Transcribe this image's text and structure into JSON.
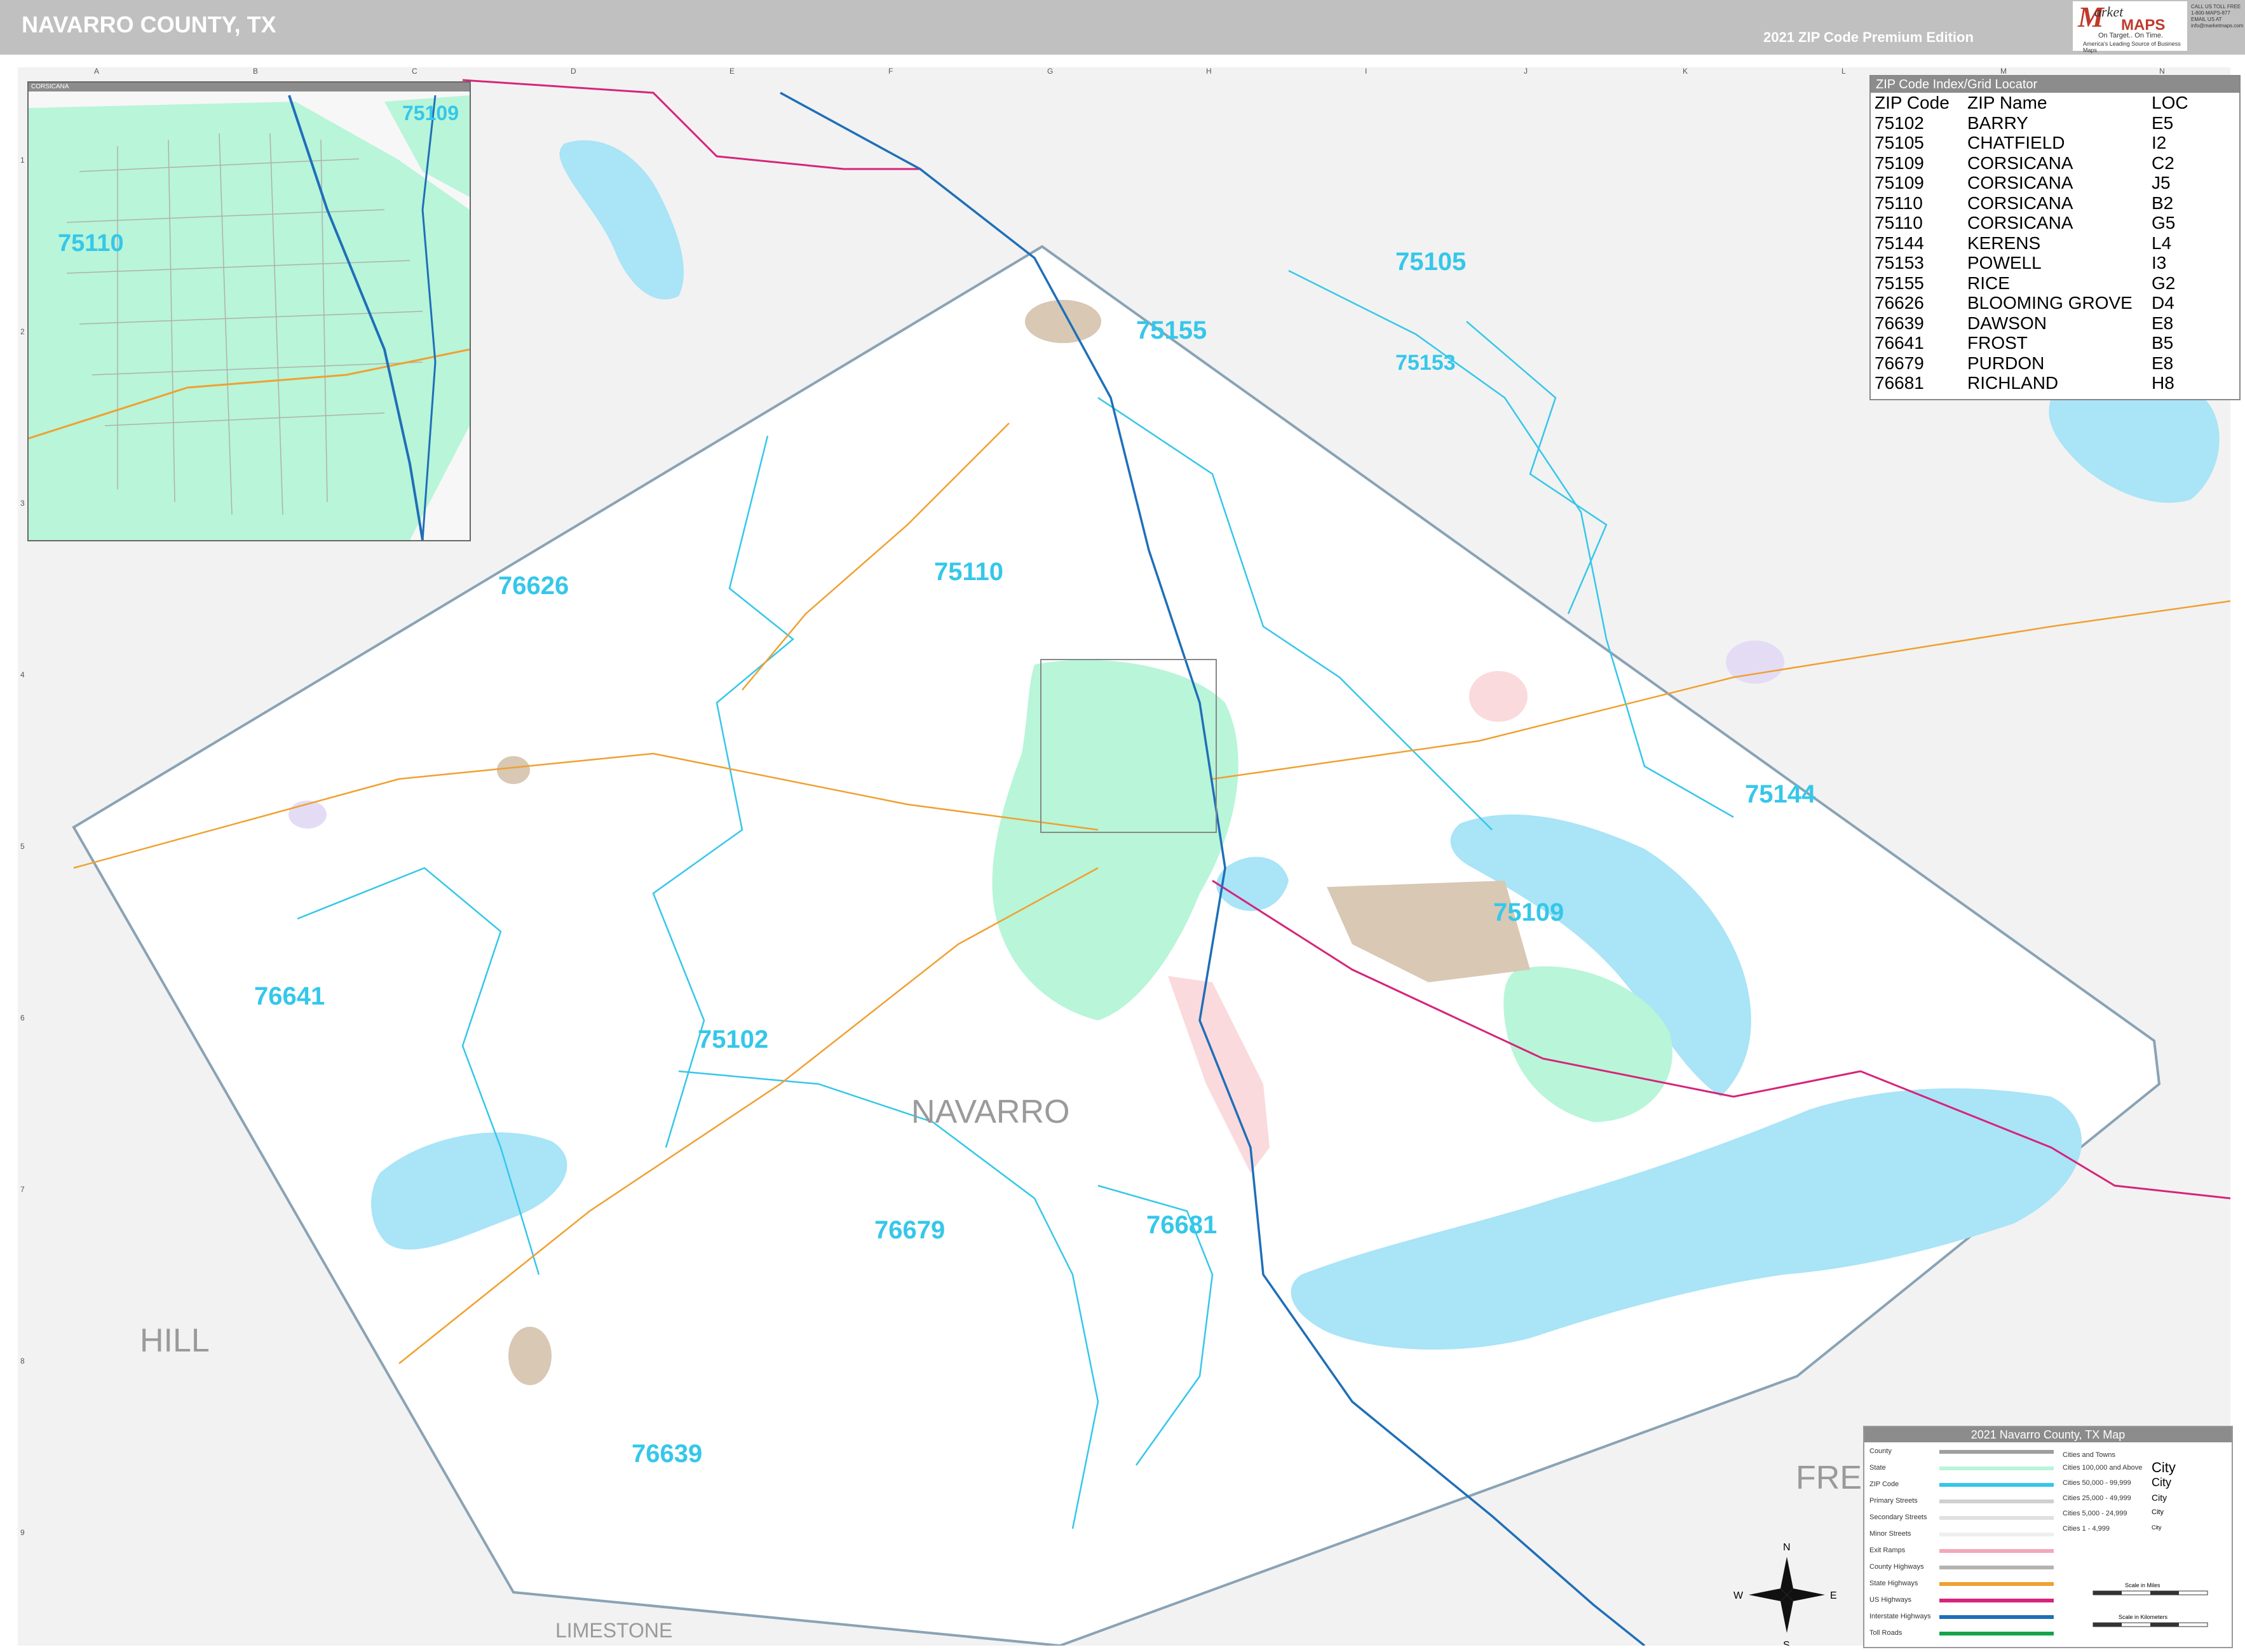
{
  "header": {
    "title": "NAVARRO COUNTY, TX",
    "edition": "2021 ZIP Code Premium Edition",
    "logo_initial": "M",
    "logo_word1": "arket",
    "logo_word2": "MAPS",
    "logo_tagline": "On Target.. On Time.",
    "logo_sub": "America's Leading Source of Business Maps",
    "contact": [
      "CALL US TOLL FREE",
      "1-800-MAPS-877",
      "EMAIL US AT",
      "info@marketmaps.com"
    ]
  },
  "grid": {
    "columns": [
      "A",
      "B",
      "C",
      "D",
      "E",
      "F",
      "G",
      "H",
      "I",
      "J",
      "K",
      "L",
      "M",
      "N"
    ],
    "rows": [
      "1",
      "2",
      "3",
      "4",
      "5",
      "6",
      "7",
      "8",
      "9"
    ]
  },
  "zip_index": {
    "title": "ZIP Code Index/Grid Locator",
    "headers": [
      "ZIP Code",
      "ZIP Name",
      "LOC"
    ],
    "rows": [
      [
        "75102",
        "BARRY",
        "E5"
      ],
      [
        "75105",
        "CHATFIELD",
        "I2"
      ],
      [
        "75109",
        "CORSICANA",
        "C2"
      ],
      [
        "75109",
        "CORSICANA",
        "J5"
      ],
      [
        "75110",
        "CORSICANA",
        "B2"
      ],
      [
        "75110",
        "CORSICANA",
        "G5"
      ],
      [
        "75144",
        "KERENS",
        "L4"
      ],
      [
        "75153",
        "POWELL",
        "I3"
      ],
      [
        "75155",
        "RICE",
        "G2"
      ],
      [
        "76626",
        "BLOOMING GROVE",
        "D4"
      ],
      [
        "76639",
        "DAWSON",
        "E8"
      ],
      [
        "76641",
        "FROST",
        "B5"
      ],
      [
        "76679",
        "PURDON",
        "E8"
      ],
      [
        "76681",
        "RICHLAND",
        "H8"
      ]
    ]
  },
  "map_labels": {
    "zips": [
      {
        "text": "75105"
      },
      {
        "text": "75155"
      },
      {
        "text": "75153"
      },
      {
        "text": "75110"
      },
      {
        "text": "76626"
      },
      {
        "text": "75144"
      },
      {
        "text": "75109"
      },
      {
        "text": "76641"
      },
      {
        "text": "75102"
      },
      {
        "text": "76679"
      },
      {
        "text": "76681"
      },
      {
        "text": "76639"
      }
    ],
    "counties": [
      "NAVARRO",
      "HILL",
      "LIMESTONE",
      "FRE"
    ]
  },
  "inset": {
    "title": "CORSICANA",
    "zips": [
      "75109",
      "75110"
    ]
  },
  "legend": {
    "title": "2021 Navarro County, TX Map",
    "items": [
      "County",
      "State",
      "ZIP Code",
      "Primary Streets",
      "Secondary Streets",
      "Minor Streets",
      "Exit Ramps",
      "County Highways",
      "State Highways",
      "US Highways",
      "Interstate Highways",
      "Toll Roads"
    ],
    "swatch_colors": [
      "#9e9e9e",
      "#b8f5d9",
      "#35c7ea",
      "#d0d0d0",
      "#e0e0e0",
      "#efefef",
      "#f4a8b8",
      "#b3b3b3",
      "#f0a030",
      "#d6247a",
      "#1f6fb8",
      "#16a34a"
    ],
    "cities_header": "Cities and Towns",
    "cities": [
      {
        "label": "Cities 100,000 and Above",
        "sample": "City"
      },
      {
        "label": "Cities 50,000 - 99,999",
        "sample": "City"
      },
      {
        "label": "Cities 25,000 - 49,999",
        "sample": "City"
      },
      {
        "label": "Cities 5,000 - 24,999",
        "sample": "City"
      },
      {
        "label": "Cities 1 - 4,999",
        "sample": "City"
      }
    ],
    "scale_miles": "Scale in Miles",
    "scale_km": "Scale in Kilometers"
  },
  "compass": {
    "n": "N",
    "s": "S",
    "e": "E",
    "w": "W"
  },
  "colors": {
    "header_gray": "#c0c0c0",
    "zip_label": "#35c7ea",
    "water": "#a9e4f7",
    "outside": "#f2f2f2",
    "urban_green": "#b8f5d9",
    "interstate": "#1f6fb8",
    "us_highway": "#d6247a",
    "state_highway": "#f0a030"
  }
}
